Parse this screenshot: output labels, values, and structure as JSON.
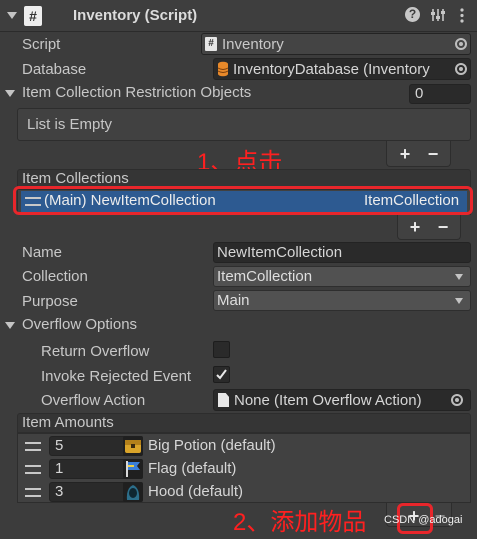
{
  "header": {
    "title": "Inventory (Script)",
    "script_symbol": "#"
  },
  "fields": {
    "script": {
      "label": "Script",
      "value": "Inventory"
    },
    "database": {
      "label": "Database",
      "value": "InventoryDatabase (Inventory"
    },
    "restriction": {
      "label": "Item Collection Restriction Objects",
      "count": "0",
      "empty_text": "List is Empty"
    }
  },
  "collections": {
    "header": "Item Collections",
    "row": {
      "name": "(Main) NewItemCollection",
      "type": "ItemCollection"
    }
  },
  "details": {
    "name": {
      "label": "Name",
      "value": "NewItemCollection"
    },
    "collection": {
      "label": "Collection",
      "value": "ItemCollection"
    },
    "purpose": {
      "label": "Purpose",
      "value": "Main"
    }
  },
  "overflow": {
    "label": "Overflow Options",
    "return_overflow": "Return Overflow",
    "invoke_rejected": "Invoke Rejected Event",
    "action_label": "Overflow Action",
    "action_value": "None (Item Overflow Action)"
  },
  "amounts": {
    "header": "Item Amounts",
    "items": [
      {
        "qty": "5",
        "name": "Big Potion (default)"
      },
      {
        "qty": "1",
        "name": "Flag (default)"
      },
      {
        "qty": "3",
        "name": "Hood (default)"
      }
    ]
  },
  "buttons": {
    "plus": "+",
    "minus": "−"
  },
  "annotations": {
    "step1": "1、点击",
    "step2": "2、添加物品",
    "watermark": "CSDN @adogai"
  }
}
